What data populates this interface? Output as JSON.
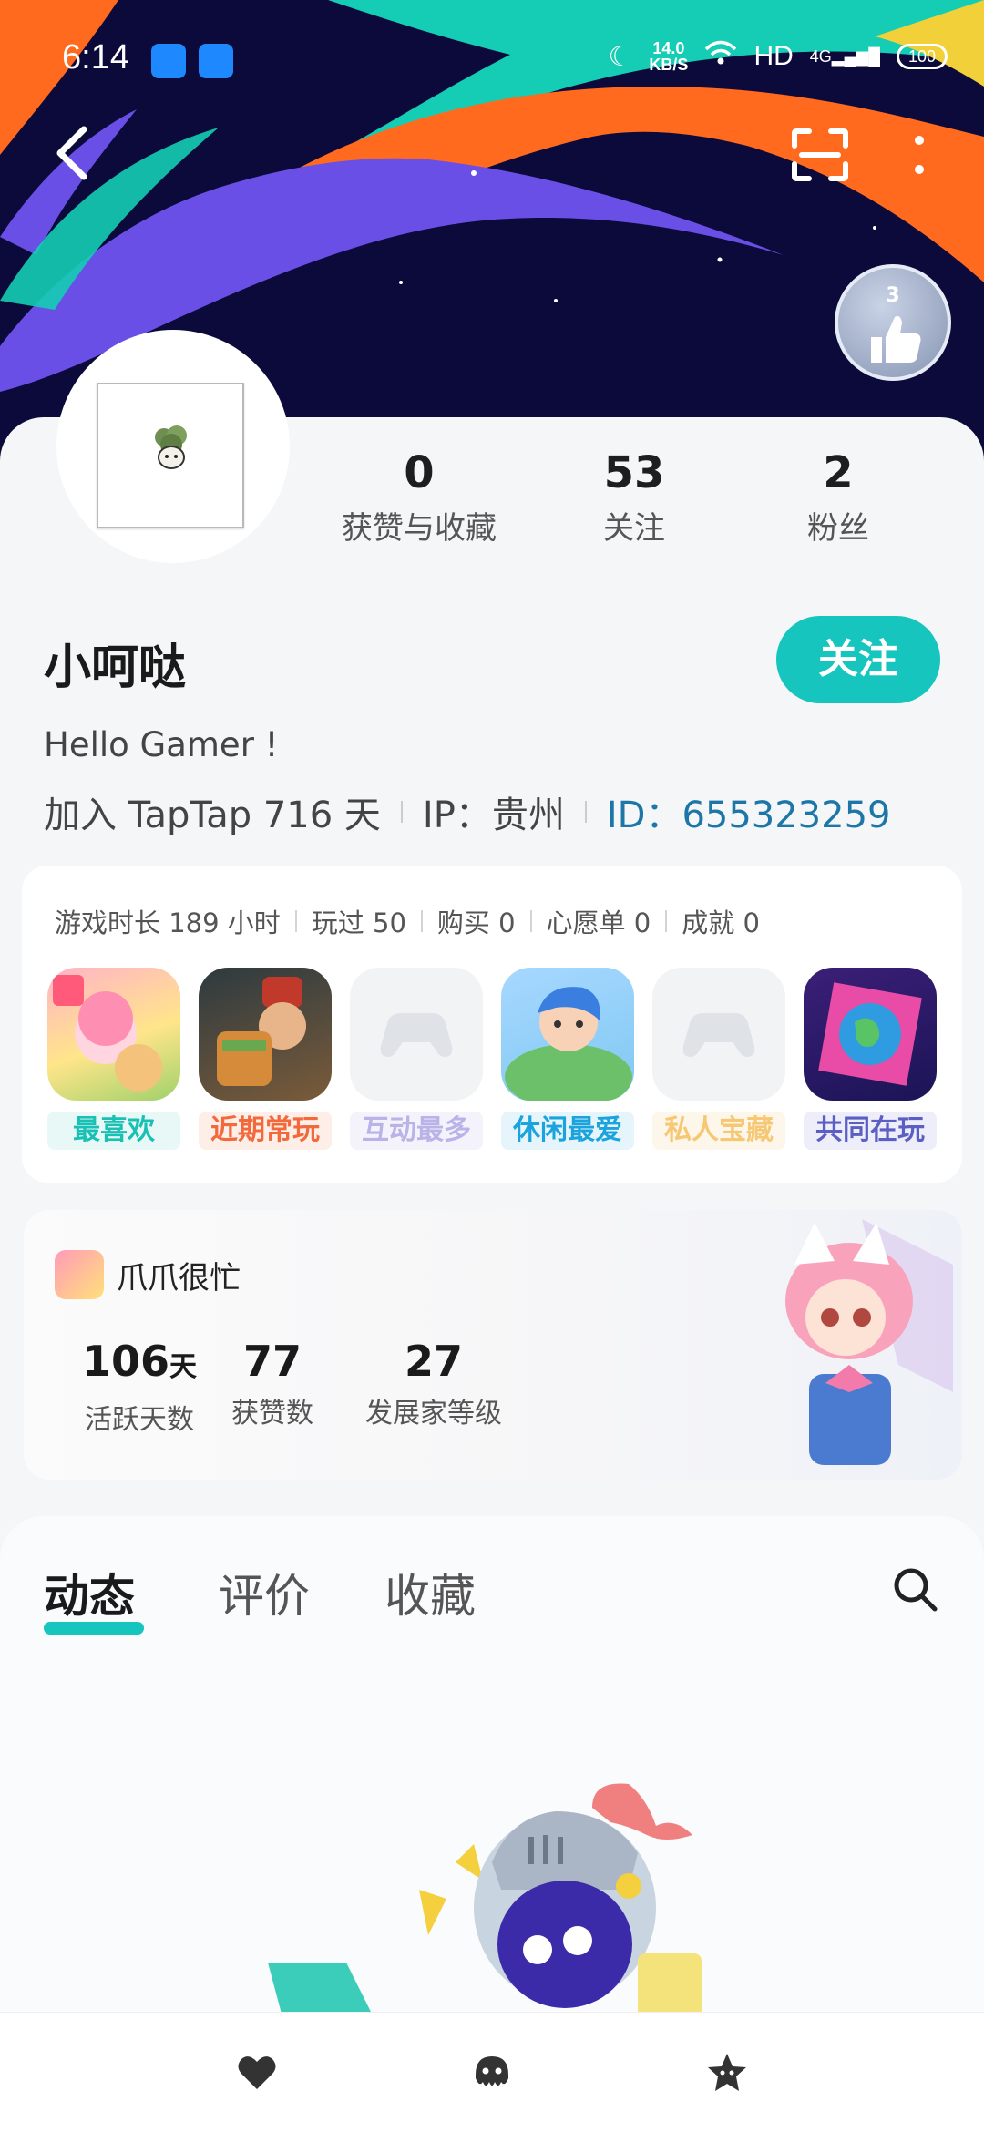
{
  "status_bar": {
    "time": "6:14",
    "speed_value": "14.0",
    "speed_unit": "KB/S",
    "network": "HD",
    "signal": "4G",
    "battery": "100"
  },
  "header": {
    "badge_level": "3",
    "icons": [
      "back-icon",
      "scan-icon",
      "more-icon"
    ]
  },
  "profile": {
    "stats": [
      {
        "value": "0",
        "label": "获赞与收藏"
      },
      {
        "value": "53",
        "label": "关注"
      },
      {
        "value": "2",
        "label": "粉丝"
      }
    ],
    "username": "小呵哒",
    "follow_label": "关注",
    "bio": "Hello Gamer !",
    "joined": "加入 TapTap 716 天",
    "ip": "IP：贵州",
    "id": "ID：655323259"
  },
  "games": {
    "stats": [
      "游戏时长 189 小时",
      "玩过 50",
      "购买 0",
      "心愿单 0",
      "成就 0"
    ],
    "items": [
      {
        "label": "最喜欢",
        "color": "#18c1b4",
        "bg": "#e7f8f6"
      },
      {
        "label": "近期常玩",
        "color": "#f26a3c",
        "bg": "#fdeee8"
      },
      {
        "label": "互动最多",
        "color": "#b9b3e8",
        "bg": "#f4f3fb"
      },
      {
        "label": "休闲最爱",
        "color": "#1ba3de",
        "bg": "#e6f4fb"
      },
      {
        "label": "私人宝藏",
        "color": "#f7c873",
        "bg": "#fdf6ea"
      },
      {
        "label": "共同在玩",
        "color": "#5b5fc4",
        "bg": "#eeeefa"
      }
    ]
  },
  "claw": {
    "game_name": "爪爪很忙",
    "stats": [
      {
        "value": "106",
        "unit": "天",
        "label": "活跃天数"
      },
      {
        "value": "77",
        "unit": "",
        "label": "获赞数"
      },
      {
        "value": "27",
        "unit": "",
        "label": "发展家等级"
      }
    ]
  },
  "tabs": [
    {
      "label": "动态",
      "active": true
    },
    {
      "label": "评价",
      "active": false
    },
    {
      "label": "收藏",
      "active": false
    }
  ],
  "bottom_bar": {
    "icons": [
      "heart-icon",
      "octopus-icon",
      "star-icon"
    ]
  },
  "colors": {
    "accent": "#15c5be",
    "link": "#1d76a8",
    "banner_bg": "#0b0a3a"
  }
}
